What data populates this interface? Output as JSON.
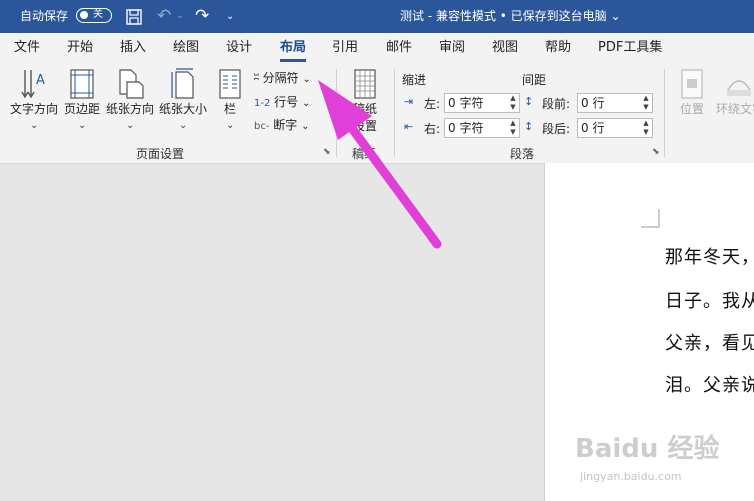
{
  "titlebar": {
    "autosave_label": "自动保存",
    "autosave_state": "关",
    "doc_title": "测试 - 兼容性模式 • 已保存到这台电脑 ⌄"
  },
  "tabs": [
    "文件",
    "开始",
    "插入",
    "绘图",
    "设计",
    "布局",
    "引用",
    "邮件",
    "审阅",
    "视图",
    "帮助",
    "PDF工具集"
  ],
  "active_tab": "布局",
  "ribbon": {
    "page_setup": {
      "text_direction": "文字方向",
      "margins": "页边距",
      "orientation": "纸张方向",
      "size": "纸张大小",
      "columns": "栏",
      "breaks": "分隔符",
      "line_numbers": "行号",
      "hyphenation": "断字",
      "group_label": "页面设置"
    },
    "manuscript": {
      "label_line1": "稿纸",
      "label_line2": "设置",
      "group_label": "稿纸"
    },
    "paragraph": {
      "indent_header": "缩进",
      "spacing_header": "间距",
      "left_label": "左:",
      "right_label": "右:",
      "before_label": "段前:",
      "after_label": "段后:",
      "left_value": "0 字符",
      "right_value": "0 字符",
      "before_value": "0 行",
      "after_value": "0 行",
      "group_label": "段落"
    },
    "arrange": {
      "position": "位置",
      "wrap_text": "环绕文字"
    }
  },
  "document": {
    "lines": [
      "那年冬天，",
      "日子。我从",
      "父亲，看见",
      "泪。父亲说"
    ]
  },
  "watermark": {
    "brand": "Baidu 经验",
    "url": "jingyan.baidu.com"
  },
  "colors": {
    "titlebar": "#2b579a",
    "arrow": "#e040d8"
  }
}
